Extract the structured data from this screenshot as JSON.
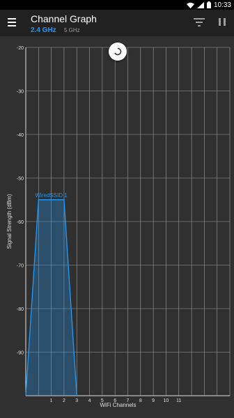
{
  "status_bar": {
    "time": "10:33"
  },
  "app_bar": {
    "title": "Channel Graph",
    "bands": [
      {
        "label": "2.4 GHz",
        "active": true
      },
      {
        "label": "5 GHz",
        "active": false
      }
    ]
  },
  "icons": {
    "menu": "menu-icon",
    "filter": "filter-icon",
    "pause": "pause-icon",
    "refresh": "refresh-icon"
  },
  "colors": {
    "accent": "#2196f3",
    "background": "#303030",
    "app_bar": "#212121",
    "grid": "#bdbdbd"
  },
  "chart_data": {
    "type": "area",
    "xlabel": "WiFi Channels",
    "ylabel": "Signal Strength (dBm)",
    "x_ticks": [
      "1",
      "2",
      "3",
      "4",
      "5",
      "6",
      "7",
      "8",
      "9",
      "10",
      "11"
    ],
    "y_ticks": [
      "-20",
      "-30",
      "-40",
      "-50",
      "-60",
      "-70",
      "-80",
      "-90"
    ],
    "xlim": [
      -1,
      15
    ],
    "ylim": [
      -100,
      -20
    ],
    "grid": true,
    "series": [
      {
        "name": "WiredSSID 1",
        "color": "#2196f3",
        "points": [
          [
            -1,
            -100
          ],
          [
            0,
            -55
          ],
          [
            2,
            -55
          ],
          [
            3,
            -100
          ]
        ]
      }
    ]
  }
}
